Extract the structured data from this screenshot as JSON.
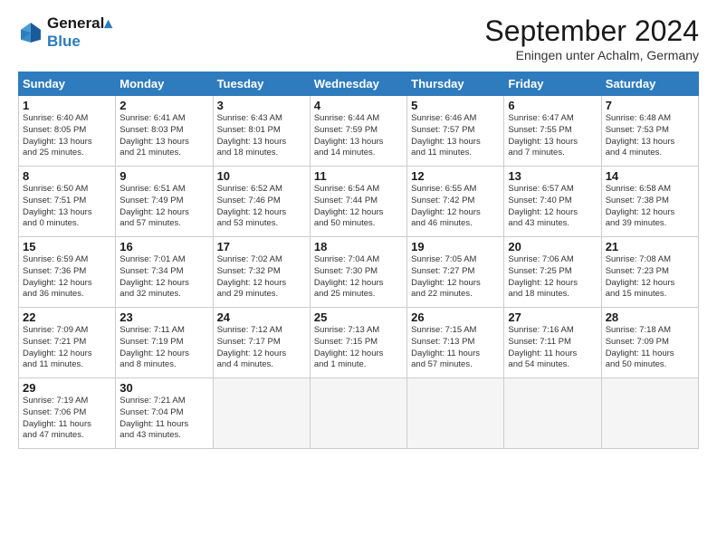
{
  "header": {
    "logo_line1": "General",
    "logo_line2": "Blue",
    "month_title": "September 2024",
    "location": "Eningen unter Achalm, Germany"
  },
  "weekdays": [
    "Sunday",
    "Monday",
    "Tuesday",
    "Wednesday",
    "Thursday",
    "Friday",
    "Saturday"
  ],
  "weeks": [
    [
      {
        "num": "1",
        "sunrise": "6:40 AM",
        "sunset": "8:05 PM",
        "daylight": "13 hours and 25 minutes."
      },
      {
        "num": "2",
        "sunrise": "6:41 AM",
        "sunset": "8:03 PM",
        "daylight": "13 hours and 21 minutes."
      },
      {
        "num": "3",
        "sunrise": "6:43 AM",
        "sunset": "8:01 PM",
        "daylight": "13 hours and 18 minutes."
      },
      {
        "num": "4",
        "sunrise": "6:44 AM",
        "sunset": "7:59 PM",
        "daylight": "13 hours and 14 minutes."
      },
      {
        "num": "5",
        "sunrise": "6:46 AM",
        "sunset": "7:57 PM",
        "daylight": "13 hours and 11 minutes."
      },
      {
        "num": "6",
        "sunrise": "6:47 AM",
        "sunset": "7:55 PM",
        "daylight": "13 hours and 7 minutes."
      },
      {
        "num": "7",
        "sunrise": "6:48 AM",
        "sunset": "7:53 PM",
        "daylight": "13 hours and 4 minutes."
      }
    ],
    [
      {
        "num": "8",
        "sunrise": "6:50 AM",
        "sunset": "7:51 PM",
        "daylight": "13 hours and 0 minutes."
      },
      {
        "num": "9",
        "sunrise": "6:51 AM",
        "sunset": "7:49 PM",
        "daylight": "12 hours and 57 minutes."
      },
      {
        "num": "10",
        "sunrise": "6:52 AM",
        "sunset": "7:46 PM",
        "daylight": "12 hours and 53 minutes."
      },
      {
        "num": "11",
        "sunrise": "6:54 AM",
        "sunset": "7:44 PM",
        "daylight": "12 hours and 50 minutes."
      },
      {
        "num": "12",
        "sunrise": "6:55 AM",
        "sunset": "7:42 PM",
        "daylight": "12 hours and 46 minutes."
      },
      {
        "num": "13",
        "sunrise": "6:57 AM",
        "sunset": "7:40 PM",
        "daylight": "12 hours and 43 minutes."
      },
      {
        "num": "14",
        "sunrise": "6:58 AM",
        "sunset": "7:38 PM",
        "daylight": "12 hours and 39 minutes."
      }
    ],
    [
      {
        "num": "15",
        "sunrise": "6:59 AM",
        "sunset": "7:36 PM",
        "daylight": "12 hours and 36 minutes."
      },
      {
        "num": "16",
        "sunrise": "7:01 AM",
        "sunset": "7:34 PM",
        "daylight": "12 hours and 32 minutes."
      },
      {
        "num": "17",
        "sunrise": "7:02 AM",
        "sunset": "7:32 PM",
        "daylight": "12 hours and 29 minutes."
      },
      {
        "num": "18",
        "sunrise": "7:04 AM",
        "sunset": "7:30 PM",
        "daylight": "12 hours and 25 minutes."
      },
      {
        "num": "19",
        "sunrise": "7:05 AM",
        "sunset": "7:27 PM",
        "daylight": "12 hours and 22 minutes."
      },
      {
        "num": "20",
        "sunrise": "7:06 AM",
        "sunset": "7:25 PM",
        "daylight": "12 hours and 18 minutes."
      },
      {
        "num": "21",
        "sunrise": "7:08 AM",
        "sunset": "7:23 PM",
        "daylight": "12 hours and 15 minutes."
      }
    ],
    [
      {
        "num": "22",
        "sunrise": "7:09 AM",
        "sunset": "7:21 PM",
        "daylight": "12 hours and 11 minutes."
      },
      {
        "num": "23",
        "sunrise": "7:11 AM",
        "sunset": "7:19 PM",
        "daylight": "12 hours and 8 minutes."
      },
      {
        "num": "24",
        "sunrise": "7:12 AM",
        "sunset": "7:17 PM",
        "daylight": "12 hours and 4 minutes."
      },
      {
        "num": "25",
        "sunrise": "7:13 AM",
        "sunset": "7:15 PM",
        "daylight": "12 hours and 1 minute."
      },
      {
        "num": "26",
        "sunrise": "7:15 AM",
        "sunset": "7:13 PM",
        "daylight": "11 hours and 57 minutes."
      },
      {
        "num": "27",
        "sunrise": "7:16 AM",
        "sunset": "7:11 PM",
        "daylight": "11 hours and 54 minutes."
      },
      {
        "num": "28",
        "sunrise": "7:18 AM",
        "sunset": "7:09 PM",
        "daylight": "11 hours and 50 minutes."
      }
    ],
    [
      {
        "num": "29",
        "sunrise": "7:19 AM",
        "sunset": "7:06 PM",
        "daylight": "11 hours and 47 minutes."
      },
      {
        "num": "30",
        "sunrise": "7:21 AM",
        "sunset": "7:04 PM",
        "daylight": "11 hours and 43 minutes."
      },
      null,
      null,
      null,
      null,
      null
    ]
  ]
}
